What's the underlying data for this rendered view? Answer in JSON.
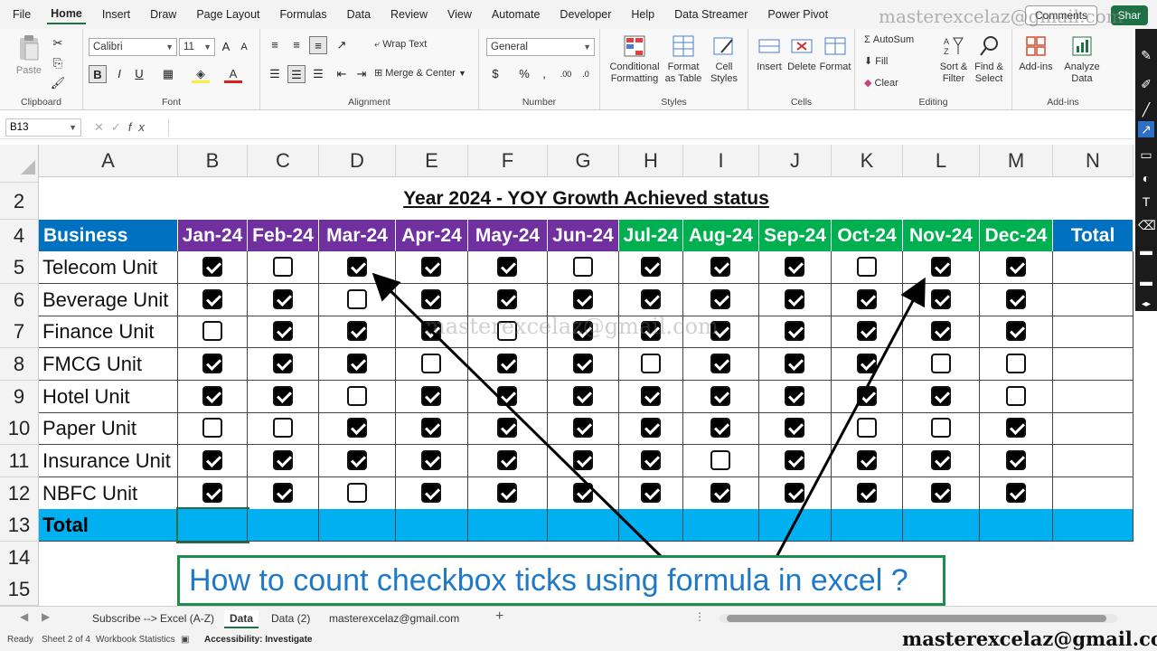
{
  "menu": [
    "File",
    "Home",
    "Insert",
    "Draw",
    "Page Layout",
    "Formulas",
    "Data",
    "Review",
    "View",
    "Automate",
    "Developer",
    "Help",
    "Data Streamer",
    "Power Pivot"
  ],
  "menu_active": "Home",
  "top_right": {
    "comments": "Comments",
    "share": "Shar"
  },
  "ribbon": {
    "clipboard": {
      "paste": "Paste",
      "label": "Clipboard"
    },
    "font": {
      "name": "Calibri",
      "size": "11",
      "label": "Font",
      "bold": "B",
      "italic": "I",
      "underline": "U"
    },
    "alignment": {
      "wrap": "Wrap Text",
      "merge": "Merge & Center",
      "label": "Alignment"
    },
    "number": {
      "format": "General",
      "label": "Number"
    },
    "styles": {
      "conditional": "Conditional Formatting",
      "format_table": "Format as Table",
      "cell_styles": "Cell Styles",
      "label": "Styles"
    },
    "cells": {
      "insert": "Insert",
      "delete": "Delete",
      "format": "Format",
      "label": "Cells"
    },
    "editing": {
      "autosum": "AutoSum",
      "fill": "Fill",
      "clear": "Clear",
      "sort": "Sort & Filter",
      "find": "Find & Select",
      "label": "Editing"
    },
    "addins": {
      "addins": "Add-ins",
      "analyze": "Analyze Data",
      "label": "Add-ins"
    }
  },
  "namebox": "B13",
  "columns": [
    "A",
    "B",
    "C",
    "D",
    "E",
    "F",
    "G",
    "H",
    "I",
    "J",
    "K",
    "L",
    "M",
    "N"
  ],
  "rows": [
    "2",
    "4",
    "5",
    "6",
    "7",
    "8",
    "9",
    "10",
    "11",
    "12",
    "13",
    "14",
    "15"
  ],
  "title": "Year 2024 - YOY Growth Achieved status",
  "header": {
    "first": "Business Units",
    "months": [
      "Jan-24",
      "Feb-24",
      "Mar-24",
      "Apr-24",
      "May-24",
      "Jun-24",
      "Jul-24",
      "Aug-24",
      "Sep-24",
      "Oct-24",
      "Nov-24",
      "Dec-24"
    ],
    "total": "Total"
  },
  "units": [
    {
      "name": "Telecom Unit",
      "checks": [
        1,
        0,
        1,
        1,
        1,
        0,
        1,
        1,
        1,
        0,
        1,
        1
      ]
    },
    {
      "name": "Beverage Unit",
      "checks": [
        1,
        1,
        0,
        1,
        1,
        1,
        1,
        1,
        1,
        1,
        1,
        1
      ]
    },
    {
      "name": "Finance Unit",
      "checks": [
        0,
        1,
        1,
        1,
        0,
        1,
        1,
        1,
        1,
        1,
        1,
        1
      ]
    },
    {
      "name": "FMCG Unit",
      "checks": [
        1,
        1,
        1,
        0,
        1,
        1,
        0,
        1,
        1,
        1,
        0,
        0
      ]
    },
    {
      "name": "Hotel Unit",
      "checks": [
        1,
        1,
        0,
        1,
        1,
        1,
        1,
        1,
        1,
        1,
        1,
        0
      ]
    },
    {
      "name": "Paper Unit",
      "checks": [
        0,
        0,
        1,
        1,
        1,
        1,
        1,
        1,
        1,
        0,
        0,
        1
      ]
    },
    {
      "name": "Insurance Unit",
      "checks": [
        1,
        1,
        1,
        1,
        1,
        1,
        1,
        0,
        1,
        1,
        1,
        1
      ]
    },
    {
      "name": "NBFC Unit",
      "checks": [
        1,
        1,
        0,
        1,
        1,
        1,
        1,
        1,
        1,
        1,
        1,
        1
      ]
    }
  ],
  "total_label": "Total",
  "caption": "How to count checkbox ticks using formula in excel ?",
  "watermark": "masterexcelaz@gmail.com",
  "colors": {
    "purple": "#7030a0",
    "green": "#00b050",
    "blue": "#0070c0",
    "total_row": "#00b0f0",
    "caption_border": "#1e8c4a",
    "caption_text": "#1f79c9"
  },
  "tabs": [
    "Subscribe --> Excel (A-Z)",
    "Data",
    "Data (2)",
    "masterexcelaz@gmail.com"
  ],
  "tab_active": "Data",
  "status": {
    "ready": "Ready",
    "sheet": "Sheet 2 of 4",
    "stats": "Workbook Statistics",
    "accessibility": "Accessibility: Investigate"
  }
}
